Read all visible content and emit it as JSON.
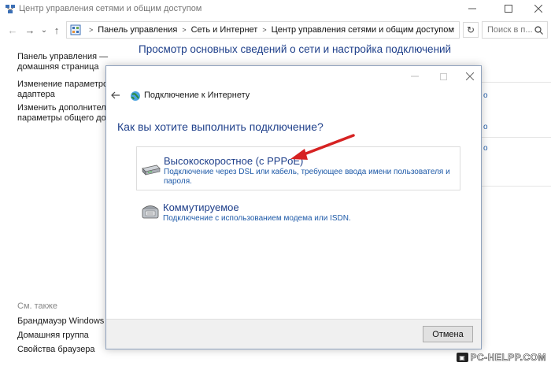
{
  "window": {
    "title": "Центр управления сетями и общим доступом"
  },
  "nav": {
    "back": "←",
    "forward": "→",
    "dropdown": "⌄",
    "up": "↑",
    "breadcrumbs": [
      "Панель управления",
      "Сеть и Интернет",
      "Центр управления сетями и общим доступом"
    ],
    "refresh": "↻",
    "search_placeholder": "Поиск в п..."
  },
  "left_panel": {
    "home_link": [
      "Панель управления —",
      "домашняя страница"
    ],
    "adapter_link": [
      "Изменение параметров",
      "адаптера"
    ],
    "sharing_link": [
      "Изменить дополнительные",
      "параметры общего доступ"
    ],
    "see_also_label": "См. также",
    "see_also": [
      "Брандмауэр Windows",
      "Домашняя группа",
      "Свойства браузера"
    ]
  },
  "main": {
    "heading": "Просмотр основных сведений о сети и настройка подключений",
    "partial_links": [
      "о",
      "о",
      "о"
    ]
  },
  "dialog": {
    "title": "Подключение к Интернету",
    "question": "Как вы хотите выполнить подключение?",
    "options": [
      {
        "title": "Высокоскоростное (с PPPoE)",
        "description": "Подключение через DSL или кабель, требующее ввода имени пользователя и пароля.",
        "icon": "modem-icon"
      },
      {
        "title": "Коммутируемое",
        "description": "Подключение с использованием модема или ISDN.",
        "icon": "dialup-icon"
      }
    ],
    "cancel_label": "Отмена"
  },
  "watermark": {
    "text": "PC-HELPP.COM"
  },
  "colors": {
    "accent": "#1e3f8a",
    "link": "#1e5aa8",
    "arrow": "#d62222"
  }
}
